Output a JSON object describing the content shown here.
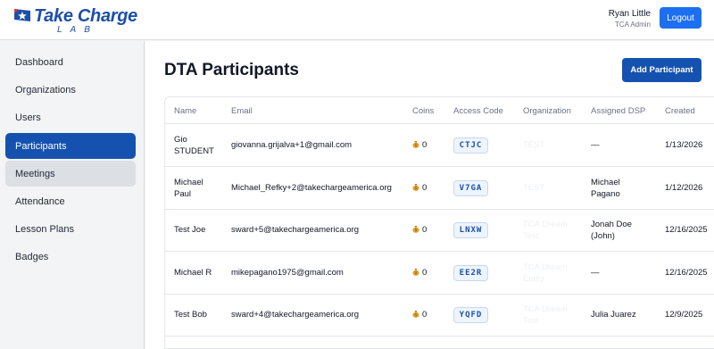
{
  "header": {
    "logo_text": "Take Charge",
    "logo_sub": "LAB",
    "user_name": "Ryan Little",
    "user_role": "TCA Admin",
    "logout_label": "Logout"
  },
  "sidebar": {
    "items": [
      {
        "label": "Dashboard",
        "state": "normal"
      },
      {
        "label": "Organizations",
        "state": "normal"
      },
      {
        "label": "Users",
        "state": "normal"
      },
      {
        "label": "Participants",
        "state": "active"
      },
      {
        "label": "Meetings",
        "state": "hover"
      },
      {
        "label": "Attendance",
        "state": "normal"
      },
      {
        "label": "Lesson Plans",
        "state": "normal"
      },
      {
        "label": "Badges",
        "state": "normal"
      }
    ]
  },
  "main": {
    "title": "DTA Participants",
    "add_label": "Add Participant",
    "columns": [
      "Name",
      "Email",
      "Coins",
      "Access Code",
      "Organization",
      "Assigned DSP",
      "Created"
    ],
    "rows": [
      {
        "name": [
          "Gio",
          "STUDENT"
        ],
        "email": "giovanna.grijalva+1@gmail.com",
        "coins": "0",
        "code": "CTJC",
        "org": [
          "TEST"
        ],
        "dsp": [
          "—"
        ],
        "created": "1/13/2026"
      },
      {
        "name": [
          "Michael",
          "Paul"
        ],
        "email": "Michael_Refky+2@takechargeamerica.org",
        "coins": "0",
        "code": "V7GA",
        "org": [
          "TEST"
        ],
        "dsp": [
          "Michael",
          "Pagano"
        ],
        "created": "1/12/2026"
      },
      {
        "name": [
          "Test Joe"
        ],
        "email": "sward+5@takechargeamerica.org",
        "coins": "0",
        "code": "LNXW",
        "org": [
          "TCA Dream",
          "Test"
        ],
        "dsp": [
          "Jonah Doe",
          "(John)"
        ],
        "created": "12/16/2025"
      },
      {
        "name": [
          "Michael R"
        ],
        "email": "mikepagano1975@gmail.com",
        "coins": "0",
        "code": "EE2R",
        "org": [
          "TCA Dream",
          "Entity"
        ],
        "dsp": [
          "—"
        ],
        "created": "12/16/2025"
      },
      {
        "name": [
          "Test Bob"
        ],
        "email": "sward+4@takechargeamerica.org",
        "coins": "0",
        "code": "YQFD",
        "org": [
          "TCA Dream",
          "Test"
        ],
        "dsp": [
          "Julia Juarez"
        ],
        "created": "12/9/2025"
      }
    ]
  },
  "colors": {
    "brand": "#1e4fa8",
    "accent": "#1552b0",
    "logout": "#1d6ff2"
  },
  "icons": {
    "logo": "star-flag-icon",
    "coin": "coin-bag-icon"
  }
}
